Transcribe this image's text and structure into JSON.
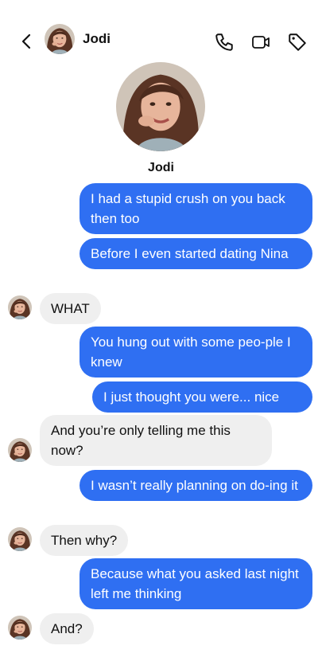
{
  "header": {
    "contact_name": "Jodi",
    "icons": [
      "back-chevron-icon",
      "phone-icon",
      "video-camera-icon",
      "tag-icon"
    ]
  },
  "profile": {
    "name": "Jodi"
  },
  "messages": [
    {
      "side": "out",
      "text": "I had a stupid crush on you back then too"
    },
    {
      "side": "out",
      "text": "Before I even started dating Nina"
    },
    {
      "side": "in",
      "text": "WHAT"
    },
    {
      "side": "out",
      "text": "You hung out with some peo-ple I knew"
    },
    {
      "side": "out",
      "text": "I just thought you were... nice"
    },
    {
      "side": "in",
      "text": "And you’re only telling me this now?"
    },
    {
      "side": "out",
      "text": "I wasn’t really planning on do-ing it"
    },
    {
      "side": "in",
      "text": "Then why?"
    },
    {
      "side": "out",
      "text": "Because what you asked last night left me thinking"
    },
    {
      "side": "in",
      "text": "And?"
    }
  ],
  "colors": {
    "outgoing_bubble": "#2f6ff2",
    "incoming_bubble": "#efefef"
  }
}
